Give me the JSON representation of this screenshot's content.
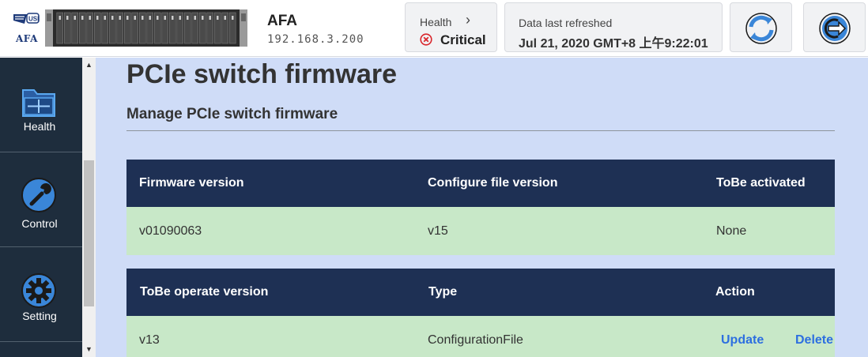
{
  "header": {
    "brand_logo_text": "USI",
    "brand_text": "AFA",
    "system_name": "AFA",
    "ip_address": "192.168.3.200",
    "health": {
      "label": "Health",
      "status": "Critical",
      "status_color": "#d9262c"
    },
    "refresh": {
      "label": "Data last refreshed",
      "timestamp": "Jul 21, 2020 GMT+8 上午9:22:01"
    },
    "buttons": {
      "refresh_icon": "refresh-icon",
      "logout_icon": "logout-icon"
    }
  },
  "sidebar": {
    "items": [
      {
        "label": "Health",
        "icon": "health-folder-icon"
      },
      {
        "label": "Control",
        "icon": "wrench-icon"
      },
      {
        "label": "Setting",
        "icon": "gear-icon"
      }
    ]
  },
  "main": {
    "title": "PCIe switch firmware",
    "subtitle": "Manage PCIe switch firmware",
    "table1": {
      "headers": [
        "Firmware version",
        "Configure file version",
        "ToBe activated"
      ],
      "row": [
        "v01090063",
        "v15",
        "None"
      ]
    },
    "table2": {
      "headers": [
        "ToBe operate version",
        "Type",
        "Action"
      ],
      "row": [
        "v13",
        "ConfigurationFile"
      ],
      "actions": [
        "Update",
        "Delete"
      ]
    }
  },
  "colors": {
    "sidebar_bg": "#1e2d3d",
    "main_bg": "#cfdcf7",
    "table_header_bg": "#1e3054",
    "table_row_bg": "#c8e8c8",
    "link": "#2d6fe0",
    "icon_blue": "#3a86d8"
  }
}
